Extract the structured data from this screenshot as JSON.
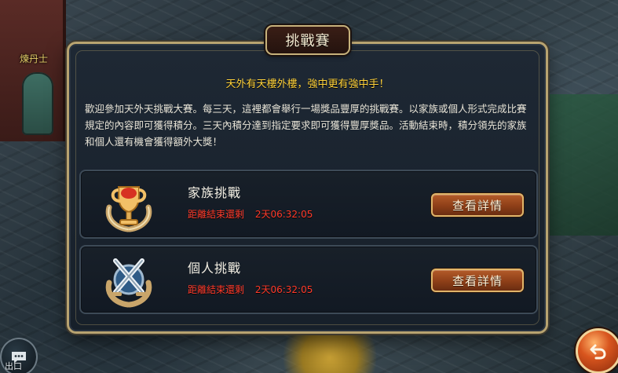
{
  "background": {
    "npc_name": "煉丹士",
    "chat_label": "出口"
  },
  "dialog": {
    "title": "挑戰賽",
    "headline": "天外有天樓外樓，強中更有強中手！",
    "description": "歡迎參加天外天挑戰大賽。每三天，這裡都會舉行一場獎品豐厚的挑戰賽。以家族或個人形式完成比賽規定的內容即可獲得積分。三天內積分達到指定要求即可獲得豐厚獎品。活動結束時，積分領先的家族和個人還有機會獲得額外大獎！",
    "cards": [
      {
        "title": "家族挑戰",
        "countdown_label": "距離結束還剩",
        "countdown_time": "2天06:32:05",
        "button_label": "查看詳情",
        "icon": "trophy-icon"
      },
      {
        "title": "個人挑戰",
        "countdown_label": "距離結束還剩",
        "countdown_time": "2天06:32:05",
        "button_label": "查看詳情",
        "icon": "crossed-swords-icon"
      }
    ]
  },
  "colors": {
    "headline": "#ffd23a",
    "countdown": "#ff3b2b",
    "frame_gold": "#b8a370",
    "button": "#a14c22"
  }
}
